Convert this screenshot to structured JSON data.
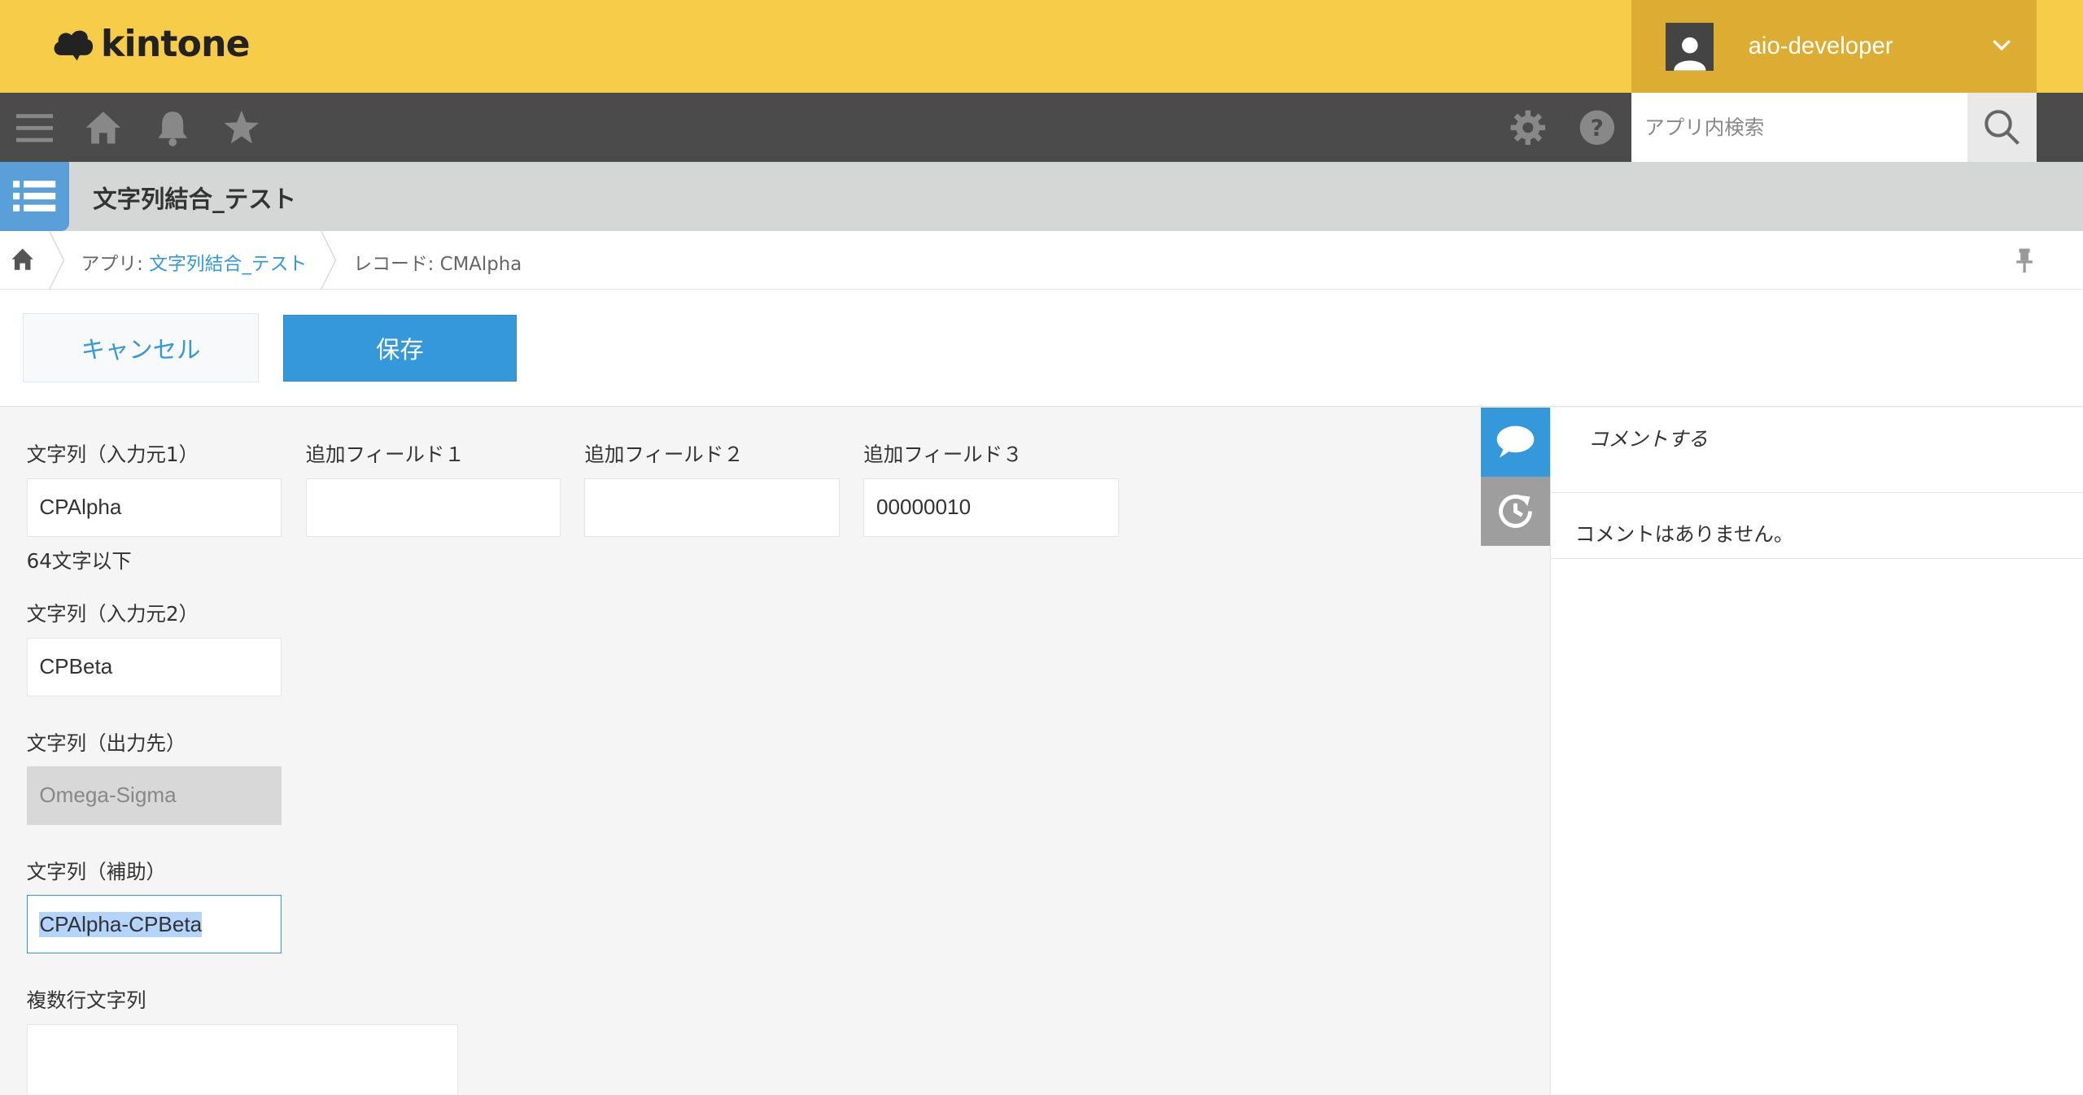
{
  "brand": {
    "logo_text": "kintone"
  },
  "user": {
    "name": "aio-developer"
  },
  "nav": {
    "search_placeholder": "アプリ内検索"
  },
  "app": {
    "title": "文字列結合_テスト"
  },
  "breadcrumb": {
    "app_prefix": "アプリ: ",
    "app_name": "文字列結合_テスト",
    "record": "レコード: CMAlpha"
  },
  "toolbar": {
    "cancel_label": "キャンセル",
    "save_label": "保存"
  },
  "form": {
    "field1": {
      "label": "文字列（入力元1）",
      "value": "CPAlpha",
      "hint": "64文字以下"
    },
    "extra1": {
      "label": "追加フィールド１",
      "value": ""
    },
    "extra2": {
      "label": "追加フィールド２",
      "value": ""
    },
    "extra3": {
      "label": "追加フィールド３",
      "value": "00000010"
    },
    "field2": {
      "label": "文字列（入力元2）",
      "value": "CPBeta"
    },
    "output": {
      "label": "文字列（出力先）",
      "value": "Omega-Sigma"
    },
    "helper": {
      "label": "文字列（補助）",
      "value": "CPAlpha-CPBeta"
    },
    "multiline": {
      "label": "複数行文字列",
      "value": ""
    }
  },
  "sidebar": {
    "comment_placeholder": "コメントする",
    "no_comments": "コメントはありません。"
  },
  "colors": {
    "topbar": "#f7cc48",
    "user_menu": "#dcac33",
    "navbar": "#4b4b4b",
    "accent": "#3498db",
    "app_header": "#d5d6d6"
  }
}
